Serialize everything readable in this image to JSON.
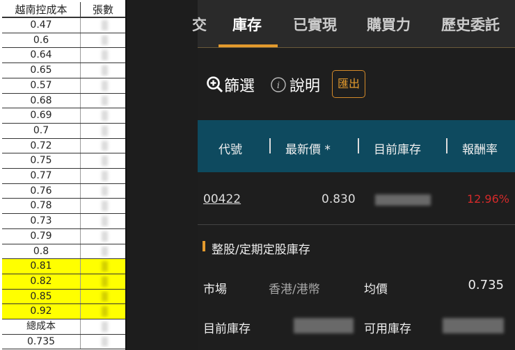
{
  "sheet": {
    "headers": [
      "越南控成本",
      "張數"
    ],
    "rows": [
      {
        "cost": "0.47",
        "hl": false
      },
      {
        "cost": "0.6",
        "hl": false
      },
      {
        "cost": "0.64",
        "hl": false
      },
      {
        "cost": "0.65",
        "hl": false
      },
      {
        "cost": "0.57",
        "hl": false
      },
      {
        "cost": "0.68",
        "hl": false
      },
      {
        "cost": "0.69",
        "hl": false
      },
      {
        "cost": "0.7",
        "hl": false
      },
      {
        "cost": "0.72",
        "hl": false
      },
      {
        "cost": "0.75",
        "hl": false
      },
      {
        "cost": "0.77",
        "hl": false
      },
      {
        "cost": "0.76",
        "hl": false
      },
      {
        "cost": "0.78",
        "hl": false
      },
      {
        "cost": "0.73",
        "hl": false
      },
      {
        "cost": "0.79",
        "hl": false
      },
      {
        "cost": "0.8",
        "hl": false
      },
      {
        "cost": "0.81",
        "hl": true
      },
      {
        "cost": "0.82",
        "hl": true
      },
      {
        "cost": "0.85",
        "hl": true
      },
      {
        "cost": "0.92",
        "hl": true
      },
      {
        "cost": "總成本",
        "hl": false
      },
      {
        "cost": "0.735",
        "hl": false
      }
    ],
    "highlight_color": "#ffff00"
  },
  "tabs": [
    "交",
    "庫存",
    "已實現",
    "購買力",
    "歷史委託"
  ],
  "active_tab": "庫存",
  "toolbar": {
    "filter": "篩選",
    "help": "說明",
    "export": "匯出"
  },
  "table": {
    "headers": [
      "代號",
      "最新價 *",
      "目前庫存",
      "報酬率"
    ],
    "row": {
      "code": "00422",
      "price": "0.830",
      "return": "12.96%"
    }
  },
  "section": {
    "title": "整股/定期定股庫存",
    "market_label": "市場",
    "market_value": "香港/港幣",
    "avg_label": "均價",
    "avg_value": "0.735",
    "current_label": "目前庫存",
    "available_label": "可用庫存"
  },
  "colors": {
    "accent": "#e39a2d",
    "header_bg": "#0e4a5f",
    "negative": "#d42a2a"
  }
}
